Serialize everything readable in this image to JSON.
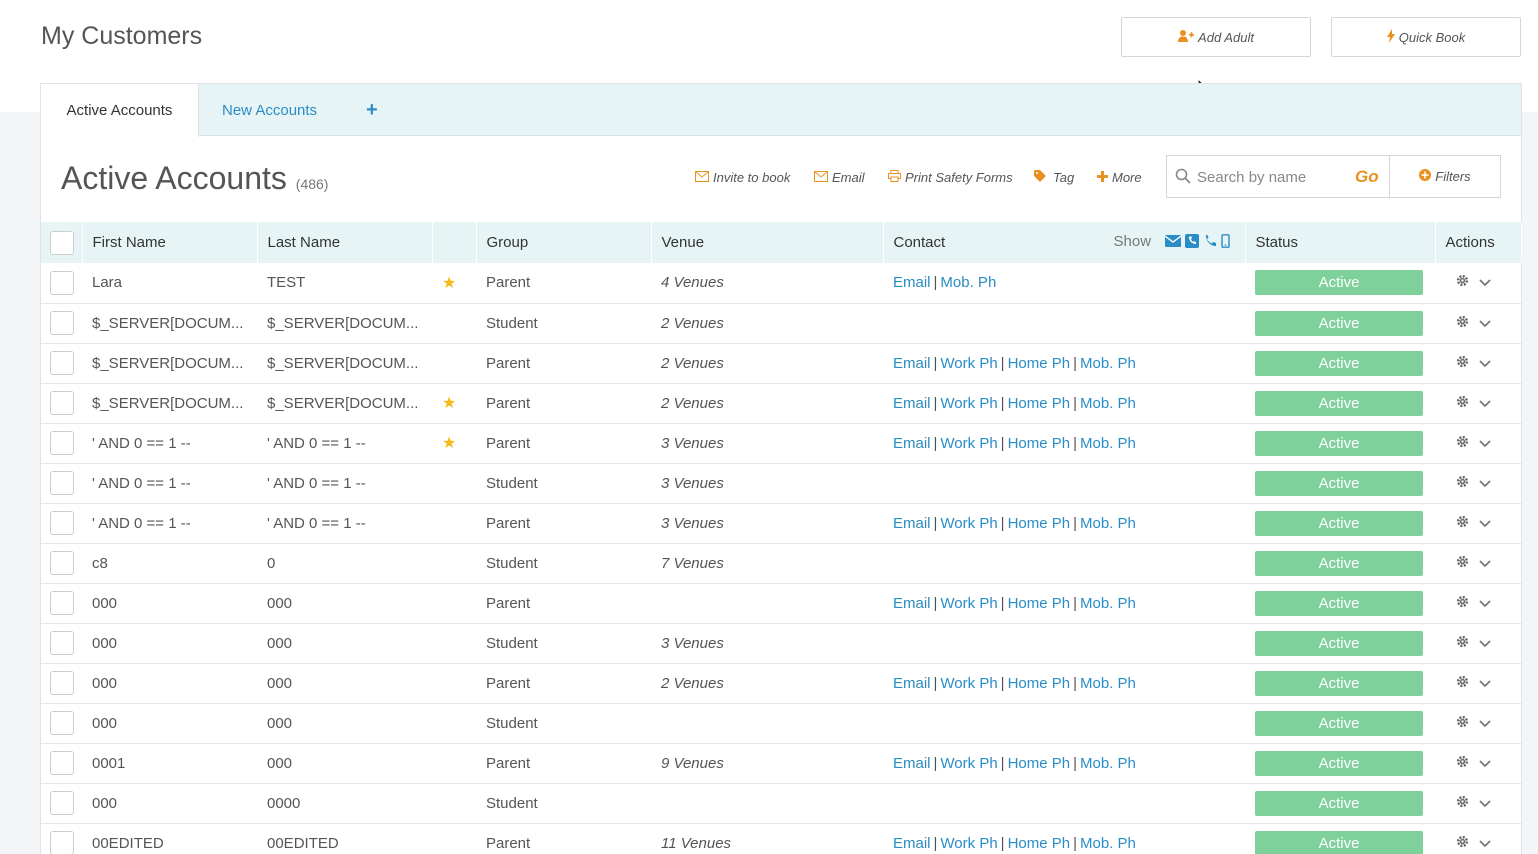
{
  "page": {
    "title": "My Customers"
  },
  "header_buttons": {
    "add_adult": "Add Adult",
    "quick_book": "Quick Book"
  },
  "tabs": [
    {
      "label": "Active Accounts",
      "active": true
    },
    {
      "label": "New Accounts",
      "active": false
    },
    {
      "label": "+",
      "active": false
    }
  ],
  "section": {
    "title": "Active Accounts",
    "count": "(486)"
  },
  "actions": {
    "invite": "Invite to book",
    "email": "Email",
    "print": "Print Safety Forms",
    "tag": "Tag",
    "more": "More"
  },
  "search": {
    "placeholder": "Search by name",
    "go": "Go"
  },
  "filters": "Filters",
  "columns": {
    "first_name": "First Name",
    "last_name": "Last Name",
    "group": "Group",
    "venue": "Venue",
    "contact": "Contact",
    "show": "Show",
    "status": "Status",
    "actions": "Actions"
  },
  "contact_labels": {
    "email": "Email",
    "work": "Work Ph",
    "home": "Home Ph",
    "mob": "Mob. Ph"
  },
  "rows": [
    {
      "first": "Lara",
      "last": "TEST",
      "star": true,
      "group": "Parent",
      "venue": "4 Venues",
      "contact": [
        "email",
        "mob"
      ],
      "status": "Active"
    },
    {
      "first": "$_SERVER[DOCUM...",
      "last": "$_SERVER[DOCUM...",
      "star": false,
      "group": "Student",
      "venue": "2 Venues",
      "contact": [],
      "status": "Active"
    },
    {
      "first": "$_SERVER[DOCUM...",
      "last": "$_SERVER[DOCUM...",
      "star": false,
      "group": "Parent",
      "venue": "2 Venues",
      "contact": [
        "email",
        "work",
        "home",
        "mob"
      ],
      "status": "Active"
    },
    {
      "first": "$_SERVER[DOCUM...",
      "last": "$_SERVER[DOCUM...",
      "star": true,
      "group": "Parent",
      "venue": "2 Venues",
      "contact": [
        "email",
        "work",
        "home",
        "mob"
      ],
      "status": "Active"
    },
    {
      "first": "' AND 0 == 1 --",
      "last": "' AND 0 == 1 --",
      "star": true,
      "group": "Parent",
      "venue": "3 Venues",
      "contact": [
        "email",
        "work",
        "home",
        "mob"
      ],
      "status": "Active"
    },
    {
      "first": "' AND 0 == 1 --",
      "last": "' AND 0 == 1 --",
      "star": false,
      "group": "Student",
      "venue": "3 Venues",
      "contact": [],
      "status": "Active"
    },
    {
      "first": "' AND 0 == 1 --",
      "last": "' AND 0 == 1 --",
      "star": false,
      "group": "Parent",
      "venue": "3 Venues",
      "contact": [
        "email",
        "work",
        "home",
        "mob"
      ],
      "status": "Active"
    },
    {
      "first": "c8",
      "last": "0",
      "star": false,
      "group": "Student",
      "venue": "7 Venues",
      "contact": [],
      "status": "Active"
    },
    {
      "first": "000",
      "last": "000",
      "star": false,
      "group": "Parent",
      "venue": "",
      "contact": [
        "email",
        "work",
        "home",
        "mob"
      ],
      "status": "Active"
    },
    {
      "first": "000",
      "last": "000",
      "star": false,
      "group": "Student",
      "venue": "3 Venues",
      "contact": [],
      "status": "Active"
    },
    {
      "first": "000",
      "last": "000",
      "star": false,
      "group": "Parent",
      "venue": "2 Venues",
      "contact": [
        "email",
        "work",
        "home",
        "mob"
      ],
      "status": "Active"
    },
    {
      "first": "000",
      "last": "000",
      "star": false,
      "group": "Student",
      "venue": "",
      "contact": [],
      "status": "Active"
    },
    {
      "first": "0001",
      "last": "000",
      "star": false,
      "group": "Parent",
      "venue": "9 Venues",
      "contact": [
        "email",
        "work",
        "home",
        "mob"
      ],
      "status": "Active"
    },
    {
      "first": "000",
      "last": "0000",
      "star": false,
      "group": "Student",
      "venue": "",
      "contact": [],
      "status": "Active"
    },
    {
      "first": "00EDITED",
      "last": "00EDITED",
      "star": false,
      "group": "Parent",
      "venue": "11 Venues",
      "contact": [
        "email",
        "work",
        "home",
        "mob"
      ],
      "status": "Active"
    }
  ],
  "colors": {
    "accent": "#e8911f",
    "link": "#2a8dc5",
    "status_active": "#7fd19c",
    "header_bg": "#e7f4f5"
  }
}
